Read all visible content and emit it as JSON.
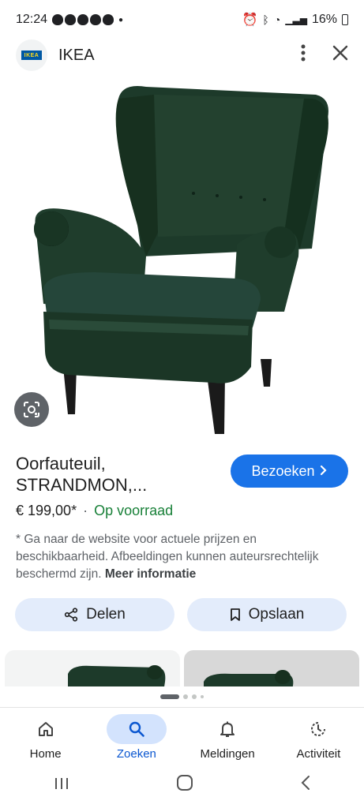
{
  "status_bar": {
    "time": "12:24",
    "battery": "16%"
  },
  "header": {
    "site_name": "IKEA",
    "logo_text": "IKEA",
    "more_icon": "more-vertical-icon",
    "close_icon": "close-icon"
  },
  "product": {
    "title_line1": "Oorfauteuil,",
    "title_line2": "STRANDMON,...",
    "visit_label": "Bezoeken",
    "price": "€ 199,00*",
    "separator": "·",
    "stock": "Op voorraad",
    "disclaimer": "* Ga naar de website voor actuele prijzen en beschikbaarheid. Afbeeldingen kunnen auteursrechtelijk beschermd zijn.",
    "more_info": "Meer informatie",
    "share_label": "Delen",
    "save_label": "Opslaan"
  },
  "colors": {
    "accent": "#1a73e8",
    "chair": "#1f3a2b",
    "stock_green": "#188038"
  },
  "bottom_nav": [
    {
      "label": "Home",
      "icon": "home-icon",
      "active": false
    },
    {
      "label": "Zoeken",
      "icon": "search-icon",
      "active": true
    },
    {
      "label": "Meldingen",
      "icon": "bell-icon",
      "active": false
    },
    {
      "label": "Activiteit",
      "icon": "activity-icon",
      "active": false
    }
  ]
}
